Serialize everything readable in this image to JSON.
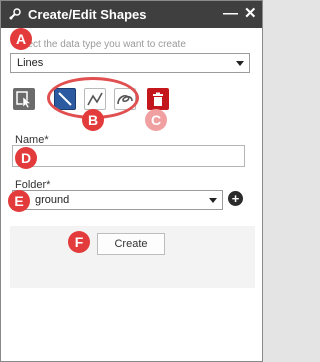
{
  "window": {
    "title": "Create/Edit Shapes",
    "minimize_label": "—",
    "close_label": "✕"
  },
  "data_type": {
    "instruction": "Select the data type you want to create",
    "selected": "Lines"
  },
  "tools": {
    "items": [
      {
        "name": "select-tool",
        "icon": "select-cursor-icon",
        "active": false
      },
      {
        "name": "line-tool",
        "icon": "straight-line-icon",
        "active": true
      },
      {
        "name": "polyline-tool",
        "icon": "polyline-icon",
        "active": false
      },
      {
        "name": "freehand-tool",
        "icon": "freehand-icon",
        "active": false
      },
      {
        "name": "delete-tool",
        "icon": "trash-icon",
        "active": false
      }
    ]
  },
  "form": {
    "name_label": "Name*",
    "name_value": "",
    "folder_label": "Folder*",
    "folder_value": "ground",
    "add_folder_label": "+",
    "create_label": "Create"
  },
  "annotations": {
    "a": "A",
    "b": "B",
    "c": "C",
    "d": "D",
    "e": "E",
    "f": "F"
  },
  "colors": {
    "titlebar": "#3f3f3f",
    "accent_active": "#2c5aa0",
    "delete": "#c4171d",
    "marker": "#e33b3b"
  }
}
